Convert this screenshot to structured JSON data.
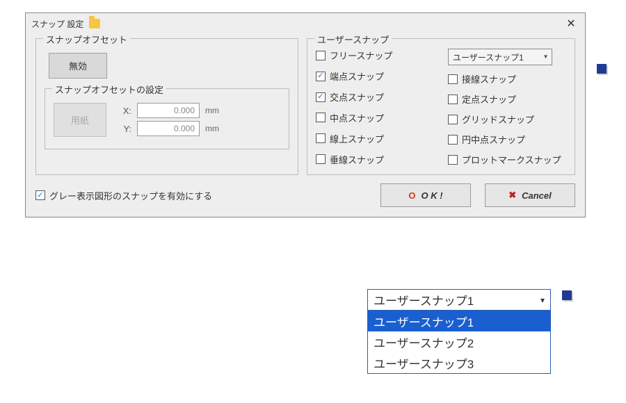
{
  "dialog": {
    "title": "スナップ 設定"
  },
  "offset": {
    "group_label": "スナップオフセット",
    "disable_button": "無効",
    "settings_label": "スナップオフセットの設定",
    "paper_button": "用紙",
    "x_label": "X:",
    "y_label": "Y:",
    "x_value": "0.000",
    "y_value": "0.000",
    "unit": "mm"
  },
  "user_snap": {
    "group_label": "ユーザースナップ",
    "combo_selected": "ユーザースナップ1",
    "col_a": [
      {
        "label": "フリースナップ",
        "checked": false
      },
      {
        "label": "端点スナップ",
        "checked": true
      },
      {
        "label": "交点スナップ",
        "checked": true
      },
      {
        "label": "中点スナップ",
        "checked": false
      },
      {
        "label": "線上スナップ",
        "checked": false
      },
      {
        "label": "垂線スナップ",
        "checked": false
      }
    ],
    "col_b": [
      {
        "label": "接線スナップ",
        "checked": false
      },
      {
        "label": "定点スナップ",
        "checked": false
      },
      {
        "label": "グリッドスナップ",
        "checked": false
      },
      {
        "label": "円中点スナップ",
        "checked": false
      },
      {
        "label": "プロットマークスナップ",
        "checked": false
      }
    ]
  },
  "footer": {
    "gray_snap_checkbox_label": "グレー表示図形のスナップを有効にする",
    "gray_snap_checked": true,
    "ok_label": "O K !",
    "cancel_label": "Cancel"
  },
  "dropdown_open": {
    "selected": "ユーザースナップ1",
    "items": [
      "ユーザースナップ1",
      "ユーザースナップ2",
      "ユーザースナップ3"
    ],
    "highlight_index": 0
  }
}
